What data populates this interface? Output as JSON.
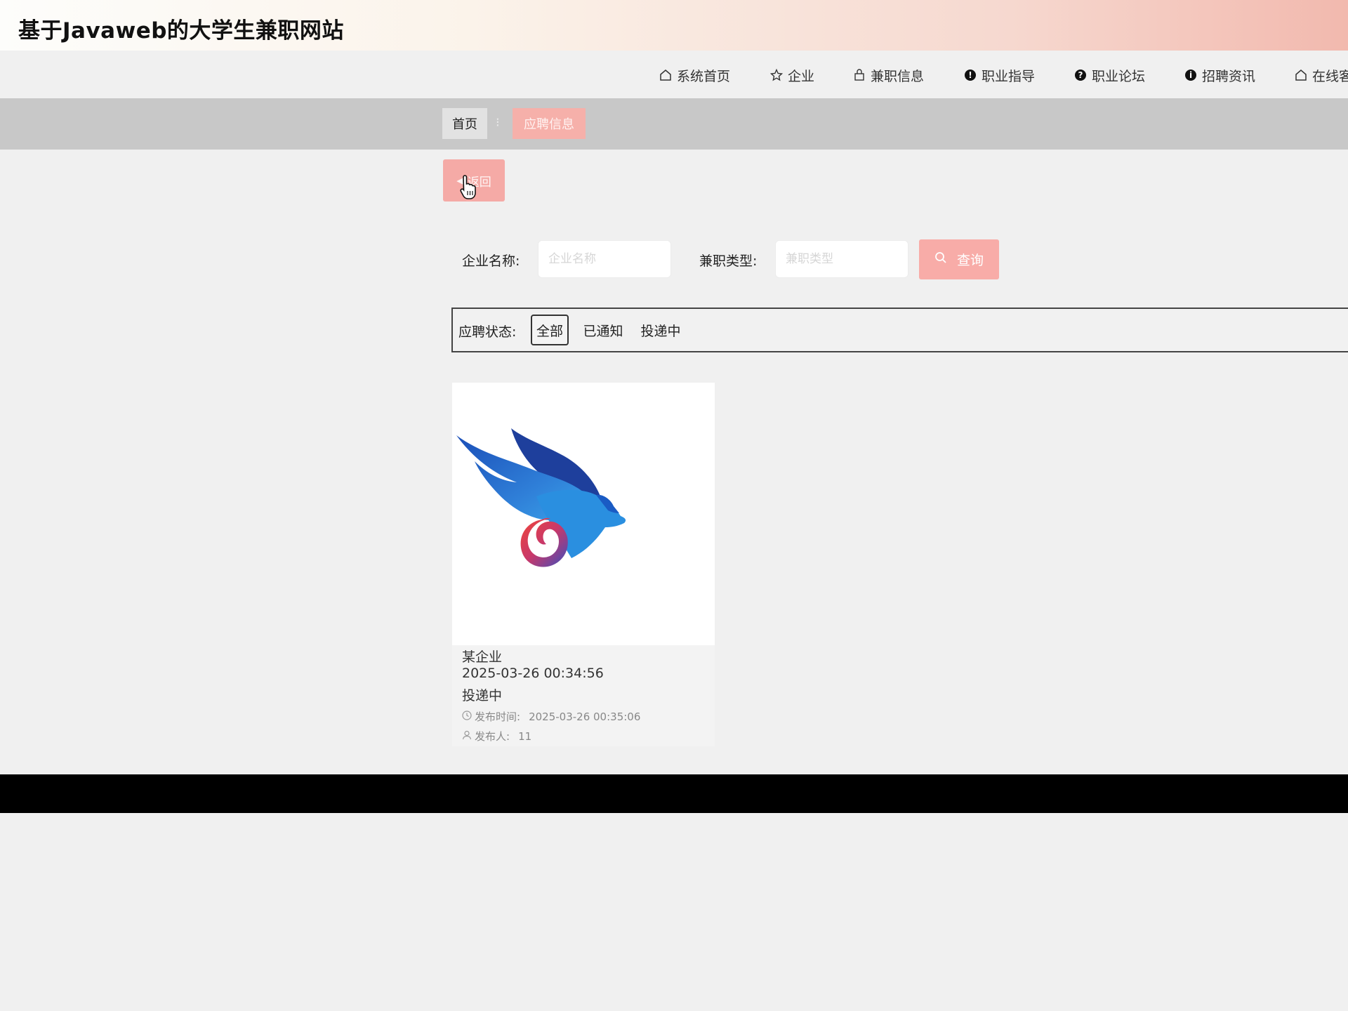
{
  "header": {
    "site_title": "基于Javaweb的大学生兼职网站"
  },
  "nav": {
    "items": [
      {
        "label": "系统首页",
        "icon": "home-icon"
      },
      {
        "label": "企业",
        "icon": "star-icon"
      },
      {
        "label": "兼职信息",
        "icon": "bag-icon"
      },
      {
        "label": "职业指导",
        "icon": "info-icon"
      },
      {
        "label": "职业论坛",
        "icon": "question-icon"
      },
      {
        "label": "招聘资讯",
        "icon": "info-icon"
      },
      {
        "label": "在线客",
        "icon": "home-icon"
      }
    ]
  },
  "breadcrumb": {
    "home": "首页",
    "separator": "⁝",
    "current": "应聘信息"
  },
  "back_button": {
    "label": "返回",
    "icon": "chevron-left-icon"
  },
  "search": {
    "company_label": "企业名称:",
    "company_placeholder": "企业名称",
    "type_label": "兼职类型:",
    "type_placeholder": "兼职类型",
    "button_label": "查询"
  },
  "status_filter": {
    "label": "应聘状态:",
    "options": [
      "全部",
      "已通知",
      "投递中"
    ],
    "selected": "全部"
  },
  "cards": [
    {
      "company": "某企业",
      "datetime": "2025-03-26 00:34:56",
      "status": "投递中",
      "publish_time_label": "发布时间:",
      "publish_time": "2025-03-26 00:35:06",
      "publisher_label": "发布人:",
      "publisher": "11",
      "image": "eagle-logo"
    }
  ],
  "colors": {
    "accent": "#f5aaa6",
    "breadcrumb_band": "#c8c8c8",
    "page_bg": "#f0f0f0"
  }
}
